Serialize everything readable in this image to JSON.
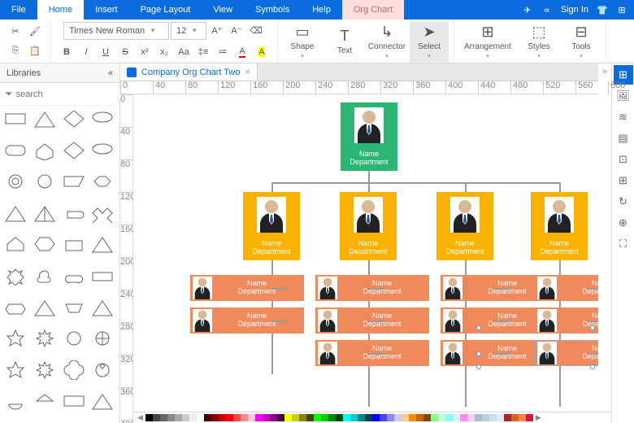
{
  "menu": {
    "file": "File",
    "home": "Home",
    "insert": "Insert",
    "pagelayout": "Page Layout",
    "view": "View",
    "symbols": "Symbols",
    "help": "Help",
    "orgchart": "Org Chart",
    "signin": "Sign In"
  },
  "ribbon": {
    "font": "Times New Roman",
    "size": "12",
    "shape": "Shape",
    "text": "Text",
    "connector": "Connector",
    "select": "Select",
    "arrangement": "Arrangement",
    "styles": "Styles",
    "tools": "Tools"
  },
  "left": {
    "title": "Libraries",
    "search_ph": "search"
  },
  "doc": {
    "tab": "Company Org Chart Two"
  },
  "node": {
    "name": "Name",
    "dept": "Department"
  },
  "colors": [
    "#000",
    "#444",
    "#666",
    "#888",
    "#aaa",
    "#ccc",
    "#eee",
    "#fff",
    "#400",
    "#800",
    "#c00",
    "#f00",
    "#f44",
    "#f88",
    "#fcc",
    "#f0f",
    "#c0c",
    "#808",
    "#404",
    "#ff0",
    "#cc0",
    "#880",
    "#440",
    "#0f0",
    "#0c0",
    "#080",
    "#040",
    "#0ff",
    "#0cc",
    "#088",
    "#044",
    "#00f",
    "#44f",
    "#88f",
    "#ccf",
    "#fc8",
    "#f80",
    "#c60",
    "#840",
    "#8f8",
    "#cfc",
    "#8ff",
    "#cff",
    "#f8f",
    "#fcf",
    "#abc",
    "#bcd",
    "#cde",
    "#def",
    "#a52a2a",
    "#d2691e",
    "#ff7f50",
    "#dc143c"
  ]
}
